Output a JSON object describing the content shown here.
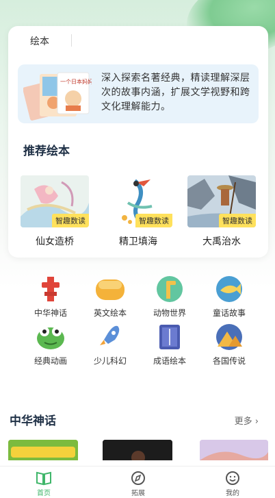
{
  "card": {
    "tab_label": "绘本",
    "intro_text": "深入探索名著经典，精读理解深层次的故事内涵，扩展文学视野和跨文化理解能力。",
    "intro_book_title": "一个日本妈妈"
  },
  "recommend": {
    "title": "推荐绘本",
    "books": [
      {
        "name": "仙女造桥",
        "badge": "智趣数读"
      },
      {
        "name": "精卫填海",
        "badge": "智趣数读"
      },
      {
        "name": "大禹治水",
        "badge": "智趣数读"
      }
    ]
  },
  "categories": [
    {
      "label": "中华神话",
      "icon": "red-totem-icon"
    },
    {
      "label": "英文绘本",
      "icon": "yellow-cushion-icon"
    },
    {
      "label": "动物世界",
      "icon": "giraffe-icon"
    },
    {
      "label": "童话故事",
      "icon": "fish-icon"
    },
    {
      "label": "经典动画",
      "icon": "frog-icon"
    },
    {
      "label": "少儿科幻",
      "icon": "rocket-icon"
    },
    {
      "label": "成语绘本",
      "icon": "book-icon"
    },
    {
      "label": "各国传说",
      "icon": "pyramid-icon"
    }
  ],
  "section2": {
    "title": "中华神话",
    "more": "更多 ›"
  },
  "nav": {
    "items": [
      {
        "label": "首页",
        "icon": "home-book-icon",
        "active": true
      },
      {
        "label": "拓展",
        "icon": "compass-icon",
        "active": false
      },
      {
        "label": "我的",
        "icon": "smile-icon",
        "active": false
      }
    ]
  },
  "colors": {
    "accent": "#3fb66a",
    "badge": "#ffe15c",
    "intro_bg": "#e8f3fb"
  }
}
